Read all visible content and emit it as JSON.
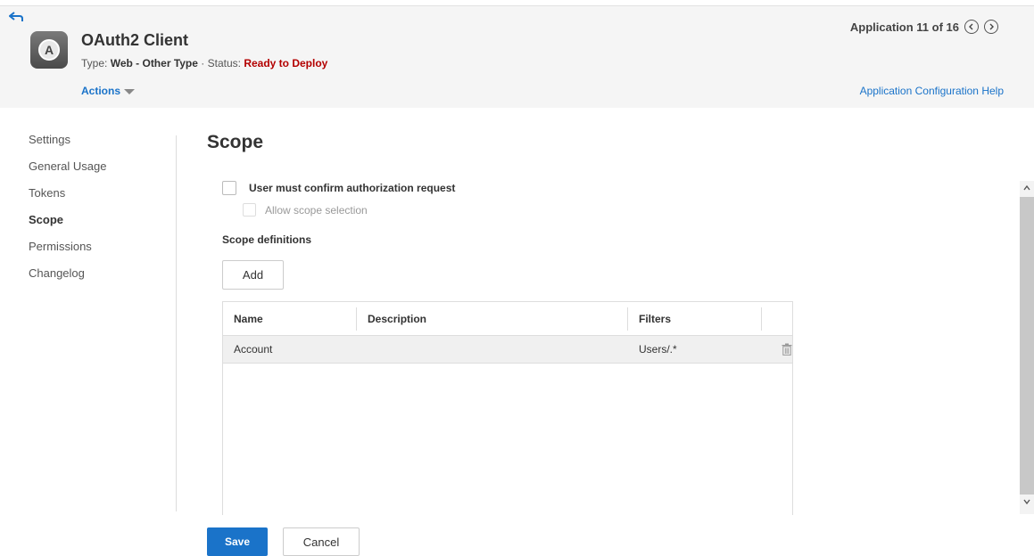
{
  "header": {
    "icon": "back-arrow-icon",
    "app_icon_letter": "A",
    "title": "OAuth2 Client",
    "type_label": "Type:",
    "type_value": "Web - Other Type",
    "separator": "·",
    "status_label": "Status:",
    "status_value": "Ready to Deploy",
    "actions_label": "Actions",
    "pager_text": "Application 11 of 16",
    "help_link": "Application Configuration Help"
  },
  "sidebar": {
    "items": [
      {
        "label": "Settings",
        "active": false
      },
      {
        "label": "General Usage",
        "active": false
      },
      {
        "label": "Tokens",
        "active": false
      },
      {
        "label": "Scope",
        "active": true
      },
      {
        "label": "Permissions",
        "active": false
      },
      {
        "label": "Changelog",
        "active": false
      }
    ]
  },
  "main": {
    "title": "Scope",
    "confirm_label": "User must confirm authorization request",
    "allow_scope_label": "Allow scope selection",
    "scope_defs_label": "Scope definitions",
    "add_label": "Add",
    "table": {
      "columns": [
        "Name",
        "Description",
        "Filters"
      ],
      "rows": [
        {
          "name": "Account",
          "description": "",
          "filters": "Users/.*"
        }
      ]
    }
  },
  "footer": {
    "save_label": "Save",
    "cancel_label": "Cancel"
  },
  "colors": {
    "accent": "#1a73c9",
    "status": "#b30000"
  }
}
